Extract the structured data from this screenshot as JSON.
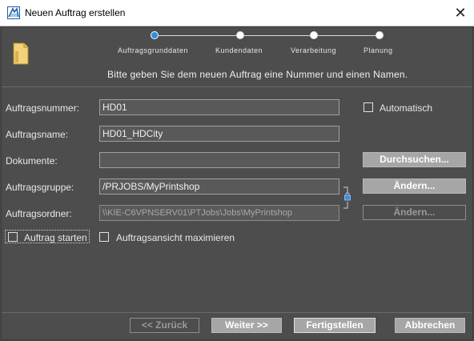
{
  "window": {
    "title": "Neuen Auftrag erstellen",
    "close_glyph": "✕",
    "app_icon": "app-logo-icon"
  },
  "steps": [
    {
      "label": "Auftragsgrunddaten",
      "active": true
    },
    {
      "label": "Kundendaten",
      "active": false
    },
    {
      "label": "Verarbeitung",
      "active": false
    },
    {
      "label": "Planung",
      "active": false
    }
  ],
  "instruction": "Bitte geben Sie dem neuen Auftrag eine Nummer und einen Namen.",
  "form": {
    "auftragsnummer": {
      "label": "Auftragsnummer:",
      "value": "HD01"
    },
    "automatisch": {
      "label": "Automatisch",
      "checked": false
    },
    "auftragsname": {
      "label": "Auftragsname:",
      "value": "HD01_HDCity"
    },
    "dokumente": {
      "label": "Dokumente:",
      "value": "",
      "button": "Durchsuchen..."
    },
    "auftragsgruppe": {
      "label": "Auftragsgruppe:",
      "value": "/PRJOBS/MyPrintshop",
      "button": "Ändern..."
    },
    "auftragsordner": {
      "label": "Auftragsordner:",
      "value": "\\\\KIE-C6VPNSERV01\\PTJobs\\Jobs\\MyPrintshop",
      "button": "Ändern..."
    },
    "auftrag_starten": {
      "label": "Auftrag starten",
      "checked": false
    },
    "ansicht_maximieren": {
      "label": "Auftragsansicht maximieren",
      "checked": false
    }
  },
  "footer": {
    "back": "<< Zurück",
    "next": "Weiter >>",
    "finish": "Fertigstellen",
    "cancel": "Abbrechen"
  },
  "colors": {
    "background": "#4d4d4d",
    "active_step": "#2c8fe6",
    "button": "#a6a6a6"
  }
}
